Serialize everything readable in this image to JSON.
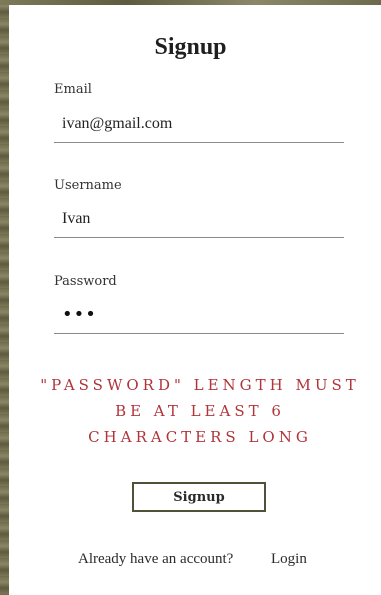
{
  "form": {
    "title": "Signup",
    "email": {
      "label": "Email",
      "value": "ivan@gmail.com"
    },
    "username": {
      "label": "Username",
      "value": "Ivan"
    },
    "password": {
      "label": "Password",
      "masked_value": "•••"
    },
    "error_message": "\"Password\" length must be at least 6 characters long",
    "submit_label": "Signup"
  },
  "footer": {
    "prompt_text": "Already have an account?",
    "login_label": "Login"
  },
  "colors": {
    "error": "#b0343a",
    "button_border": "#4f5236",
    "background_texture": "#6f6b4b"
  }
}
